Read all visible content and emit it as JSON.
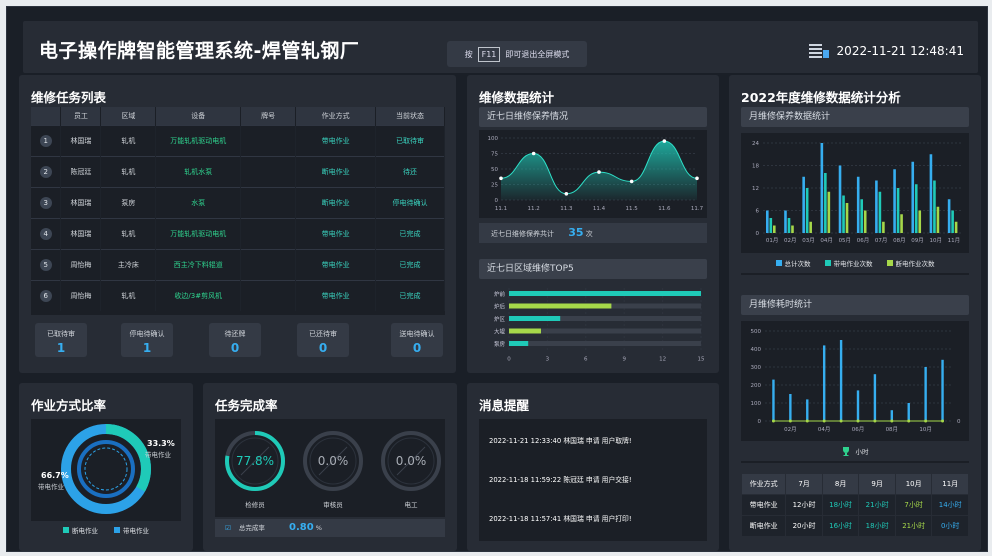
{
  "header": {
    "title": "电子操作牌智能管理系统-焊管轧钢厂",
    "hint_pre": "按",
    "hint_key": "F11",
    "hint_post": "即可退出全屏模式",
    "datetime": "2022-11-21 12:48:41"
  },
  "tasks": {
    "title": "维修任务列表",
    "columns": [
      "",
      "员工",
      "区域",
      "设备",
      "牌号",
      "作业方式",
      "当前状态"
    ],
    "rows": [
      [
        "1",
        "林国瑞",
        "轧机",
        "万能轧机驱动电机",
        "",
        "带电作业",
        "已取待审"
      ],
      [
        "2",
        "陈冠廷",
        "轧机",
        "轧机水泵",
        "",
        "断电作业",
        "待还"
      ],
      [
        "3",
        "林国瑞",
        "泵房",
        "水泵",
        "",
        "断电作业",
        "停电待确认"
      ],
      [
        "4",
        "林国瑞",
        "轧机",
        "万能轧机驱动电机",
        "",
        "带电作业",
        "已完成"
      ],
      [
        "5",
        "周怡梅",
        "主冷床",
        "西主冷下料辊道",
        "",
        "带电作业",
        "已完成"
      ],
      [
        "6",
        "周怡梅",
        "轧机",
        "收边/3#剪风机",
        "",
        "带电作业",
        "已完成"
      ]
    ],
    "stats": [
      {
        "label": "已取待审",
        "value": "1"
      },
      {
        "label": "停电待确认",
        "value": "1"
      },
      {
        "label": "待还牌",
        "value": "0"
      },
      {
        "label": "已还待审",
        "value": "0"
      },
      {
        "label": "送电待确认",
        "value": "0"
      }
    ]
  },
  "repair": {
    "title": "维修数据统计",
    "week_title": "近七日维修保养情况",
    "week_total_label": "近七日维修保养共计",
    "week_total": "35",
    "week_unit": "次",
    "top5_title": "近七日区域维修TOP5"
  },
  "annual": {
    "title": "2022年度维修数据统计分析",
    "monthly_title": "月维修保养数据统计",
    "legend": [
      "总计次数",
      "带电作业次数",
      "断电作业次数"
    ],
    "hours_title": "月维修耗时统计",
    "hours_legend": "小时",
    "table": {
      "header": [
        "作业方式",
        "7月",
        "8月",
        "9月",
        "10月",
        "11月"
      ],
      "rows": [
        [
          "带电作业",
          "12小时",
          "18小时",
          "21小时",
          "7小时",
          "14小时"
        ],
        [
          "断电作业",
          "20小时",
          "16小时",
          "18小时",
          "21小时",
          "0小时"
        ]
      ]
    }
  },
  "mode": {
    "title": "作业方式比率",
    "p1": "33.3%",
    "l1": "带电作业",
    "p2": "66.7%",
    "l2": "带电作业",
    "legend": [
      "断电作业",
      "带电作业"
    ]
  },
  "complete": {
    "title": "任务完成率",
    "gauges": [
      {
        "label": "检修员",
        "value": "77.8%",
        "frac": 0.778
      },
      {
        "label": "审核员",
        "value": "0.0%",
        "frac": 0
      },
      {
        "label": "电工",
        "value": "0.0%",
        "frac": 0
      }
    ],
    "total_label": "总完成率",
    "total": "0.80",
    "total_unit": "%"
  },
  "messages": {
    "title": "消息提醒",
    "items": [
      "2022-11-21 12:33:40 林国瑞 申请 用户取牌!",
      "2022-11-18 11:59:22 陈冠廷 申请 用户交接!",
      "2022-11-18 11:57:41 林国瑞 申请 用户打印!"
    ]
  },
  "chart_data": [
    {
      "type": "area",
      "x": [
        "11.1",
        "11.2",
        "11.3",
        "11.4",
        "11.5",
        "11.6",
        "11.7"
      ],
      "values": [
        35,
        75,
        10,
        45,
        30,
        95,
        35
      ],
      "ylim": [
        0,
        100
      ],
      "yticks": [
        0,
        25,
        50,
        75,
        100
      ]
    },
    {
      "type": "bar",
      "categories": [
        "炉前",
        "炉后",
        "炉区",
        "大辊",
        "泵房"
      ],
      "values": [
        15,
        8,
        4,
        2.5,
        1.5
      ],
      "xlim": [
        0,
        15
      ],
      "xticks": [
        0,
        3,
        6,
        9,
        12,
        15
      ]
    },
    {
      "type": "bar",
      "categories": [
        "01月",
        "02月",
        "03月",
        "04月",
        "05月",
        "06月",
        "07月",
        "08月",
        "09月",
        "10月",
        "11月"
      ],
      "series": [
        {
          "name": "总计次数",
          "values": [
            6,
            6,
            15,
            24,
            18,
            15,
            14,
            17,
            19,
            21,
            9
          ]
        },
        {
          "name": "带电作业次数",
          "values": [
            4,
            4,
            12,
            16,
            10,
            9,
            11,
            12,
            13,
            14,
            6
          ]
        },
        {
          "name": "断电作业次数",
          "values": [
            2,
            2,
            3,
            11,
            8,
            6,
            3,
            5,
            6,
            7,
            3
          ]
        }
      ],
      "ylim": [
        0,
        24
      ],
      "yticks": [
        0,
        6,
        12,
        18,
        24
      ]
    },
    {
      "type": "bar",
      "categories": [
        "01月",
        "02月",
        "03月",
        "04月",
        "05月",
        "06月",
        "07月",
        "08月",
        "09月",
        "10月",
        "11月"
      ],
      "series": [
        {
          "name": "小时",
          "values": [
            230,
            150,
            120,
            420,
            450,
            170,
            260,
            60,
            100,
            300,
            340
          ]
        }
      ],
      "ylim": [
        0,
        500
      ],
      "yticks": [
        0,
        100,
        200,
        300,
        400,
        500
      ],
      "xticks": [
        "02月",
        "04月",
        "06月",
        "08月",
        "10月"
      ]
    }
  ]
}
